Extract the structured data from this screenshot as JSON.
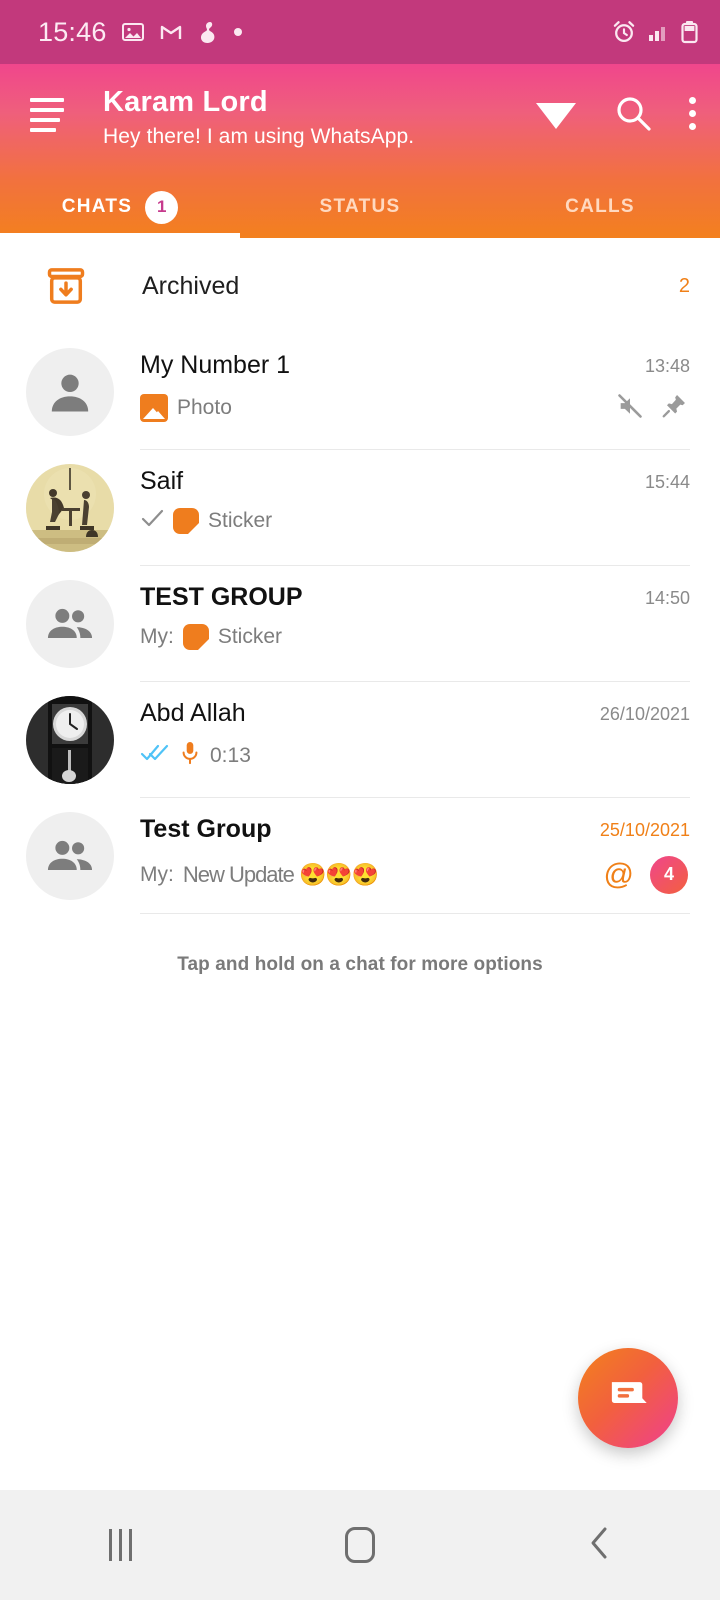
{
  "statusbar": {
    "time": "15:46",
    "left_icons": [
      "image-icon",
      "gmail-icon",
      "app-icon",
      "dot-icon"
    ],
    "right_icons": [
      "alarm-icon",
      "signal-icon",
      "battery-icon"
    ],
    "bg_color": "#c2397c"
  },
  "header": {
    "menu_icon": "hamburger-icon",
    "title": "Karam Lord",
    "subtitle": "Hey there! I am using WhatsApp.",
    "actions": [
      "wifi-icon",
      "search-icon",
      "overflow-menu-icon"
    ],
    "gradient_from": "#f0468c",
    "gradient_to": "#f3801e"
  },
  "tabs": [
    {
      "label": "CHATS",
      "badge": "1",
      "active": true
    },
    {
      "label": "STATUS",
      "badge": "",
      "active": false
    },
    {
      "label": "CALLS",
      "badge": "",
      "active": false
    }
  ],
  "archived": {
    "label": "Archived",
    "count": "2",
    "icon": "archive-box-icon",
    "accent": "#f08018"
  },
  "chats": [
    {
      "name": "My Number 1",
      "message": "Photo",
      "time": "13:48",
      "avatar": "person-placeholder",
      "msg_icon": "photo-icon",
      "muted": true,
      "pinned": true,
      "unread": "",
      "mention": false,
      "tick": ""
    },
    {
      "name": "Saif",
      "message": "Sticker",
      "time": "15:44",
      "avatar": "photo-sepia-illustration",
      "msg_icon": "sticker-icon",
      "muted": false,
      "pinned": false,
      "unread": "",
      "mention": false,
      "tick": "single-check"
    },
    {
      "name": "TEST GROUP",
      "message": "Sticker",
      "prefix": "My:",
      "time": "14:50",
      "avatar": "group-placeholder",
      "msg_icon": "sticker-icon",
      "muted": false,
      "pinned": false,
      "unread": "",
      "mention": false,
      "tick": ""
    },
    {
      "name": "Abd Allah",
      "message": "0:13",
      "time": "26/10/2021",
      "avatar": "photo-bw-clock",
      "msg_icon": "microphone-icon",
      "muted": false,
      "pinned": false,
      "unread": "",
      "mention": false,
      "tick": "double-check-blue"
    },
    {
      "name": "Test Group",
      "message": "New Update 😍😍😍",
      "prefix": "My:",
      "time": "25/10/2021",
      "avatar": "group-placeholder",
      "msg_icon": "",
      "muted": false,
      "pinned": false,
      "unread": "4",
      "mention": true,
      "tick": ""
    }
  ],
  "hint": "Tap and hold on a chat for more options",
  "fab": {
    "icon": "new-chat-icon"
  },
  "navbar": {
    "recents": "recents-icon",
    "home": "home-icon",
    "back": "back-icon"
  }
}
